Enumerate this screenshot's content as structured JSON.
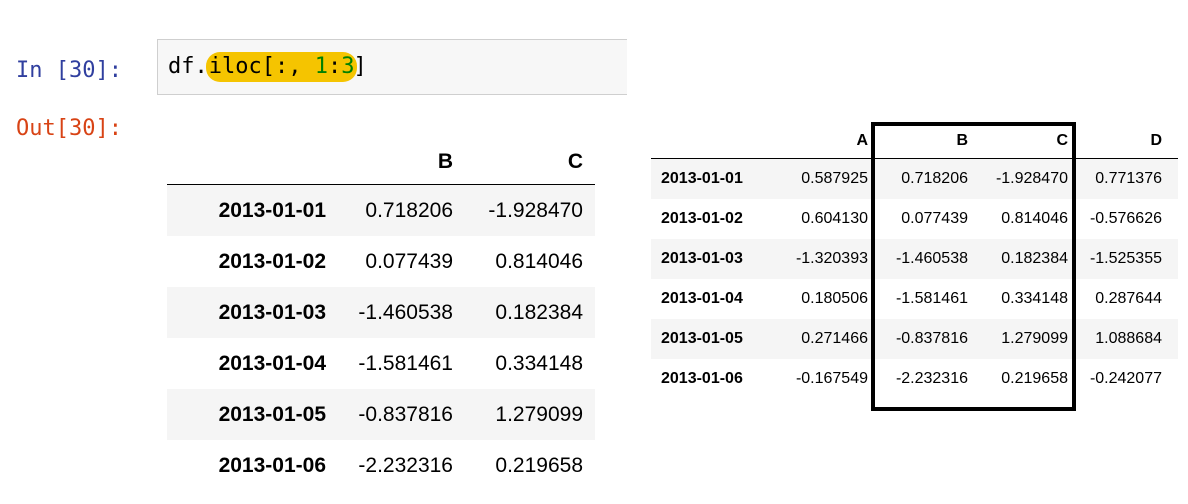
{
  "notebook": {
    "in_prompt": "In [30]:",
    "out_prompt": "Out[30]:",
    "code": {
      "prefix": "df.",
      "highlight_fn": "iloc[:, ",
      "highlight_num1": "1",
      "highlight_colon": ":",
      "highlight_num2": "3",
      "suffix": "]"
    },
    "highlight_color": "#f5c400"
  },
  "result": {
    "columns": [
      "",
      "B",
      "C"
    ],
    "rows": [
      [
        "2013-01-01",
        "0.718206",
        "-1.928470"
      ],
      [
        "2013-01-02",
        "0.077439",
        "0.814046"
      ],
      [
        "2013-01-03",
        "-1.460538",
        "0.182384"
      ],
      [
        "2013-01-04",
        "-1.581461",
        "0.334148"
      ],
      [
        "2013-01-05",
        "-0.837816",
        "1.279099"
      ],
      [
        "2013-01-06",
        "-2.232316",
        "0.219658"
      ]
    ]
  },
  "dataframe": {
    "columns": [
      "",
      "A",
      "B",
      "C",
      "D"
    ],
    "rows": [
      [
        "2013-01-01",
        "0.587925",
        "0.718206",
        "-1.928470",
        "0.771376"
      ],
      [
        "2013-01-02",
        "0.604130",
        "0.077439",
        "0.814046",
        "-0.576626"
      ],
      [
        "2013-01-03",
        "-1.320393",
        "-1.460538",
        "0.182384",
        "-1.525355"
      ],
      [
        "2013-01-04",
        "0.180506",
        "-1.581461",
        "0.334148",
        "0.287644"
      ],
      [
        "2013-01-05",
        "0.271466",
        "-0.837816",
        "1.279099",
        "1.088684"
      ],
      [
        "2013-01-06",
        "-0.167549",
        "-2.232316",
        "0.219658",
        "-0.242077"
      ]
    ]
  }
}
